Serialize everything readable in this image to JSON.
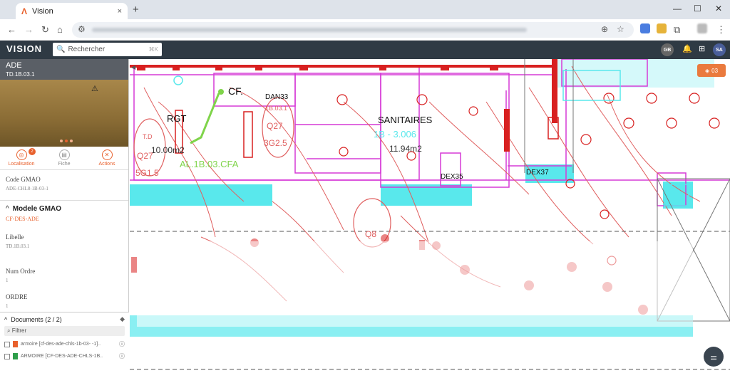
{
  "browser": {
    "tab_title": "Vision",
    "new_tab": "+",
    "close_tab": "×",
    "minimize": "—",
    "maximize": "☐",
    "close_window": "✕"
  },
  "app": {
    "logo": "VISION",
    "search_placeholder": "Rechercher",
    "search_shortcut": "⌘K",
    "user_initials_1": "GB",
    "user_initials_2": "SA"
  },
  "panel": {
    "title": "ADE",
    "subtitle": "TD.1B.03.1",
    "actions": [
      {
        "label": "Localisation",
        "badge": "2"
      },
      {
        "label": "Fiche"
      },
      {
        "label": "Actions"
      }
    ],
    "code_gmao_label": "Code GMAO",
    "code_gmao_value": "ADE-CHL8-1B-03-1",
    "modele_title": "Modele GMAO",
    "modele_value": "CF-DES-ADE",
    "libelle_label": "Libelle",
    "libelle_value": "TD.1B.03.1",
    "num_ordre_label": "Num Ordre",
    "num_ordre_value": "1",
    "ordre_label": "ORDRE",
    "ordre_value": "1"
  },
  "documents": {
    "title": "Documents (2 / 2)",
    "filter_placeholder": "Filtrer",
    "items": [
      {
        "name": "armoire [cf-des-ade-chls-1b-03- -1].."
      },
      {
        "name": "ARMOIRE [CF-DES-ADE-CHLS-1B.."
      }
    ]
  },
  "map": {
    "layers_count": "03",
    "labels": {
      "cf": "CF.",
      "rgt": "RGT",
      "dan33": "DAN33",
      "sanitaires": "SANITAIRES",
      "dex35": "DEX35",
      "dex37": "DEX37",
      "area1": "10.00m2",
      "area2": "11.94m2",
      "al": "AL.1B.03.CFA",
      "q27": "Q27",
      "q27b": "Q27",
      "g25": "3G2.5",
      "g15": "5G1.5",
      "q8": "Q8",
      "td": "T.D",
      "tdb": "1B.03.1",
      "room": "1B - 3.006"
    }
  },
  "colors": {
    "accent": "#e8602c",
    "header": "#2f3a44",
    "magenta": "#d63ad6",
    "cyan": "#59e8ec",
    "red": "#d82020"
  }
}
